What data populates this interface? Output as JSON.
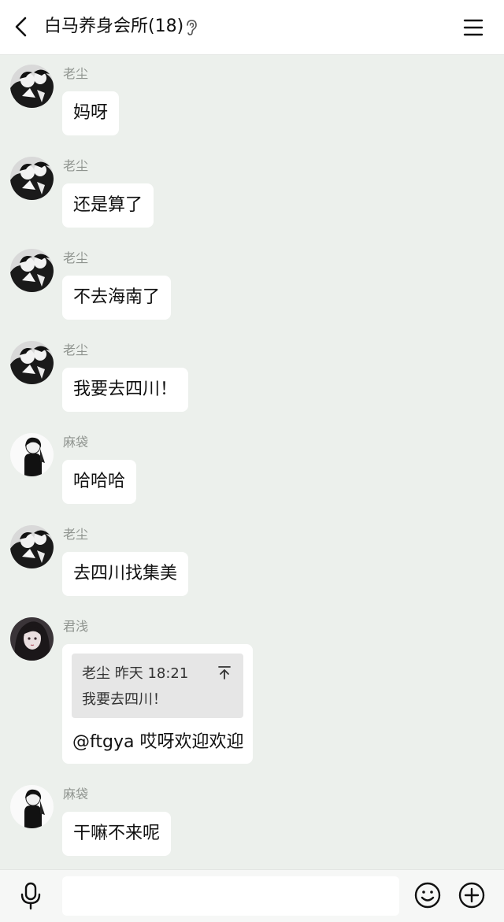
{
  "header": {
    "title": "白马养身会所(18)",
    "back_icon": "chevron-left-icon",
    "ear_icon": "ear-icon",
    "menu_icon": "hamburger-menu-icon"
  },
  "messages": [
    {
      "sender": "老尘",
      "text": "妈呀",
      "avatar": "laochen"
    },
    {
      "sender": "老尘",
      "text": "还是算了",
      "avatar": "laochen"
    },
    {
      "sender": "老尘",
      "text": "不去海南了",
      "avatar": "laochen"
    },
    {
      "sender": "老尘",
      "text": "我要去四川！",
      "avatar": "laochen"
    },
    {
      "sender": "麻袋",
      "text": "哈哈哈",
      "avatar": "madai"
    },
    {
      "sender": "老尘",
      "text": "去四川找集美",
      "avatar": "laochen"
    },
    {
      "sender": "君浅",
      "avatar": "junqian",
      "quote": {
        "meta": "老尘 昨天 18:21",
        "text": "我要去四川！"
      },
      "text": "@ftgya 哎呀欢迎欢迎"
    },
    {
      "sender": "麻袋",
      "text": "干嘛不来呢",
      "avatar": "madai"
    }
  ],
  "input_bar": {
    "voice_icon": "microphone-icon",
    "input_placeholder": "",
    "emoji_icon": "smiley-icon",
    "plus_icon": "plus-circle-icon"
  },
  "colors": {
    "chat_background": "#ecf0ec",
    "bubble": "#ffffff",
    "quote_box": "#e6e6e6",
    "sender_name": "#8f948f"
  }
}
